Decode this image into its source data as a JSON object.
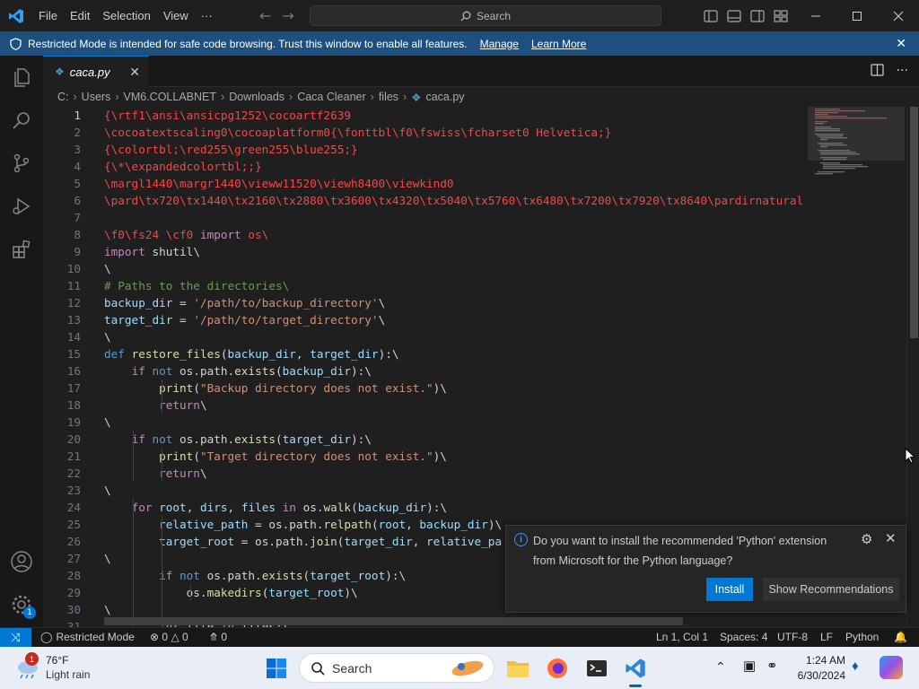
{
  "menu": {
    "items": [
      "File",
      "Edit",
      "Selection",
      "View",
      "···"
    ]
  },
  "search": {
    "label": "Search"
  },
  "banner": {
    "message": "Restricted Mode is intended for safe code browsing. Trust this window to enable all features.",
    "manage": "Manage",
    "learn_more": "Learn More"
  },
  "tab": {
    "filename": "caca.py"
  },
  "breadcrumb": [
    "C:",
    "Users",
    "VM6.COLLABNET",
    "Downloads",
    "Caca Cleaner",
    "files",
    "caca.py"
  ],
  "code": {
    "line_numbers": [
      "1",
      "2",
      "3",
      "4",
      "5",
      "6",
      "7",
      "8",
      "9",
      "10",
      "11",
      "12",
      "13",
      "14",
      "15",
      "16",
      "17",
      "18",
      "19",
      "20",
      "21",
      "22",
      "23",
      "24",
      "25",
      "26",
      "27",
      "28",
      "29",
      "30",
      "31"
    ],
    "lines": [
      [
        [
          "red",
          "{\\rtf1\\ansi\\ansicpg1252\\cocoartf2639"
        ]
      ],
      [
        [
          "red",
          "\\cocoatextscaling0\\cocoaplatform0{\\fonttbl\\f0\\fswiss\\fcharset0 Helvetica;}"
        ]
      ],
      [
        [
          "red",
          "{\\colortbl;\\red255\\green255\\blue255;}"
        ]
      ],
      [
        [
          "red",
          "{\\*\\expandedcolortbl;;}"
        ]
      ],
      [
        [
          "red",
          "\\margl1440\\margr1440\\vieww11520\\viewh8400\\viewkind0"
        ]
      ],
      [
        [
          "red",
          "\\pard\\tx720\\tx1440\\tx2160\\tx2880\\tx3600\\tx4320\\tx5040\\tx5760\\tx6480\\tx7200\\tx7920\\tx8640\\pardirnatural"
        ]
      ],
      [],
      [
        [
          "red",
          "\\f0\\fs24 \\cf0 "
        ],
        [
          "kw",
          "import"
        ],
        [
          "red",
          " os\\"
        ]
      ],
      [
        [
          "kw",
          "import"
        ],
        [
          "plain",
          " shutil\\"
        ]
      ],
      [
        [
          "plain",
          "\\"
        ]
      ],
      [
        [
          "cm",
          "# Paths to the directories\\"
        ]
      ],
      [
        [
          "var",
          "backup_dir"
        ],
        [
          "plain",
          " = "
        ],
        [
          "str",
          "'/path/to/backup_directory'"
        ],
        [
          "plain",
          "\\"
        ]
      ],
      [
        [
          "var",
          "target_dir"
        ],
        [
          "plain",
          " = "
        ],
        [
          "str",
          "'/path/to/target_directory'"
        ],
        [
          "plain",
          "\\"
        ]
      ],
      [
        [
          "plain",
          "\\"
        ]
      ],
      [
        [
          "kwb",
          "def"
        ],
        [
          "plain",
          " "
        ],
        [
          "fn",
          "restore_files"
        ],
        [
          "plain",
          "("
        ],
        [
          "var",
          "backup_dir"
        ],
        [
          "plain",
          ", "
        ],
        [
          "var",
          "target_dir"
        ],
        [
          "plain",
          "):\\"
        ]
      ],
      [
        [
          "plain",
          "    "
        ],
        [
          "kw",
          "if"
        ],
        [
          "plain",
          " "
        ],
        [
          "kwb",
          "not"
        ],
        [
          "plain",
          " os.path."
        ],
        [
          "fn",
          "exists"
        ],
        [
          "plain",
          "("
        ],
        [
          "var",
          "backup_dir"
        ],
        [
          "plain",
          "):\\"
        ]
      ],
      [
        [
          "plain",
          "        "
        ],
        [
          "fn",
          "print"
        ],
        [
          "plain",
          "("
        ],
        [
          "str",
          "\"Backup directory does not exist.\""
        ],
        [
          "plain",
          ")\\"
        ]
      ],
      [
        [
          "plain",
          "        "
        ],
        [
          "kw",
          "return"
        ],
        [
          "plain",
          "\\"
        ]
      ],
      [
        [
          "plain",
          "\\"
        ]
      ],
      [
        [
          "plain",
          "    "
        ],
        [
          "kw",
          "if"
        ],
        [
          "plain",
          " "
        ],
        [
          "kwb",
          "not"
        ],
        [
          "plain",
          " os.path."
        ],
        [
          "fn",
          "exists"
        ],
        [
          "plain",
          "("
        ],
        [
          "var",
          "target_dir"
        ],
        [
          "plain",
          "):\\"
        ]
      ],
      [
        [
          "plain",
          "        "
        ],
        [
          "fn",
          "print"
        ],
        [
          "plain",
          "("
        ],
        [
          "str",
          "\"Target directory does not exist.\""
        ],
        [
          "plain",
          ")\\"
        ]
      ],
      [
        [
          "plain",
          "        "
        ],
        [
          "kw",
          "return"
        ],
        [
          "plain",
          "\\"
        ]
      ],
      [
        [
          "plain",
          "\\"
        ]
      ],
      [
        [
          "plain",
          "    "
        ],
        [
          "kw",
          "for"
        ],
        [
          "plain",
          " "
        ],
        [
          "var",
          "root"
        ],
        [
          "plain",
          ", "
        ],
        [
          "var",
          "dirs"
        ],
        [
          "plain",
          ", "
        ],
        [
          "var",
          "files"
        ],
        [
          "plain",
          " "
        ],
        [
          "kw",
          "in"
        ],
        [
          "plain",
          " os."
        ],
        [
          "fn",
          "walk"
        ],
        [
          "plain",
          "("
        ],
        [
          "var",
          "backup_dir"
        ],
        [
          "plain",
          "):\\"
        ]
      ],
      [
        [
          "plain",
          "        "
        ],
        [
          "var",
          "relative_path"
        ],
        [
          "plain",
          " = os.path."
        ],
        [
          "fn",
          "relpath"
        ],
        [
          "plain",
          "("
        ],
        [
          "var",
          "root"
        ],
        [
          "plain",
          ", "
        ],
        [
          "var",
          "backup_dir"
        ],
        [
          "plain",
          ")\\"
        ]
      ],
      [
        [
          "plain",
          "        "
        ],
        [
          "var",
          "target_root"
        ],
        [
          "plain",
          " = os.path."
        ],
        [
          "fn",
          "join"
        ],
        [
          "plain",
          "("
        ],
        [
          "var",
          "target_dir"
        ],
        [
          "plain",
          ", "
        ],
        [
          "var",
          "relative_pa"
        ]
      ],
      [
        [
          "plain",
          "\\"
        ]
      ],
      [
        [
          "plain",
          "        "
        ],
        [
          "kw",
          "if"
        ],
        [
          "plain",
          " "
        ],
        [
          "kwb",
          "not"
        ],
        [
          "plain",
          " os.path."
        ],
        [
          "fn",
          "exists"
        ],
        [
          "plain",
          "("
        ],
        [
          "var",
          "target_root"
        ],
        [
          "plain",
          "):\\"
        ]
      ],
      [
        [
          "plain",
          "            os."
        ],
        [
          "fn",
          "makedirs"
        ],
        [
          "plain",
          "("
        ],
        [
          "var",
          "target_root"
        ],
        [
          "plain",
          ")\\"
        ]
      ],
      [
        [
          "plain",
          "\\"
        ]
      ],
      [
        [
          "plain",
          "        "
        ],
        [
          "kw",
          "for"
        ],
        [
          "plain",
          " "
        ],
        [
          "var",
          "file"
        ],
        [
          "plain",
          " "
        ],
        [
          "kw",
          "in"
        ],
        [
          "plain",
          " "
        ],
        [
          "var",
          "files"
        ],
        [
          "plain",
          ":\\"
        ]
      ]
    ]
  },
  "notification": {
    "message": "Do you want to install the recommended 'Python' extension from Microsoft for the Python language?",
    "install": "Install",
    "show_recommendations": "Show Recommendations"
  },
  "status": {
    "restricted": "Restricted Mode",
    "errors": "0",
    "warnings": "0",
    "ports": "0",
    "cursor": "Ln 1, Col 1",
    "spaces": "Spaces: 4",
    "encoding": "UTF-8",
    "eol": "LF",
    "language": "Python"
  },
  "activity": {
    "accounts_badge": "1"
  },
  "taskbar": {
    "weather_temp": "76°F",
    "weather_desc": "Light rain",
    "weather_badge": "1",
    "search": "Search",
    "time": "1:24 AM",
    "date": "6/30/2024"
  },
  "colors": {
    "accent": "#0078d4",
    "banner": "#1d4f7f",
    "editor_bg": "#1f1f1f"
  }
}
